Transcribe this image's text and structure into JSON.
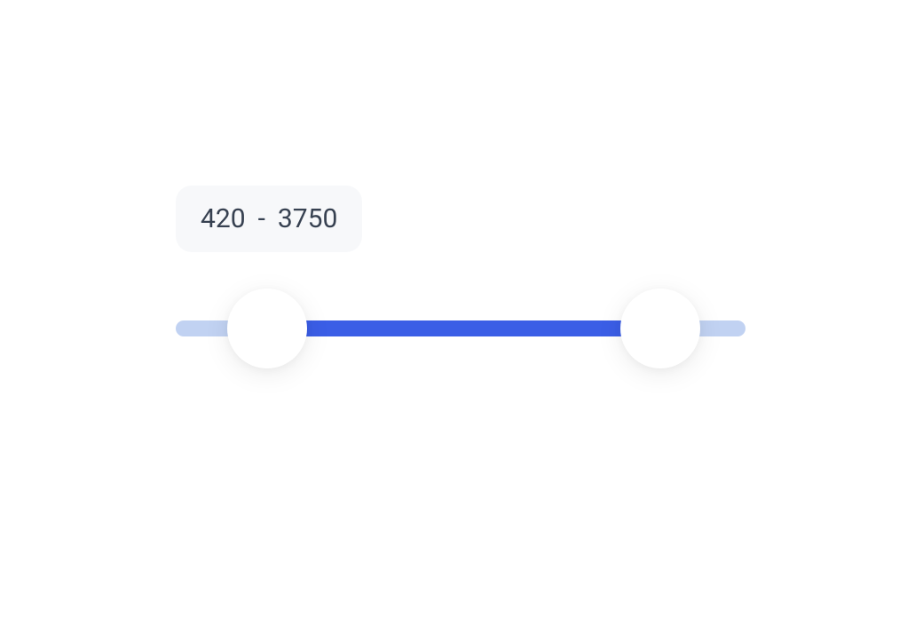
{
  "slider": {
    "min": 0,
    "max": 5000,
    "lowValue": 420,
    "highValue": 3750,
    "separator": "-",
    "lowPercent": 16,
    "highPercent": 85,
    "colors": {
      "rail": "#c1d2f2",
      "track": "#3b5ee6",
      "handle": "#ffffff",
      "badgeBg": "#f7f8fa",
      "text": "#374151"
    }
  }
}
